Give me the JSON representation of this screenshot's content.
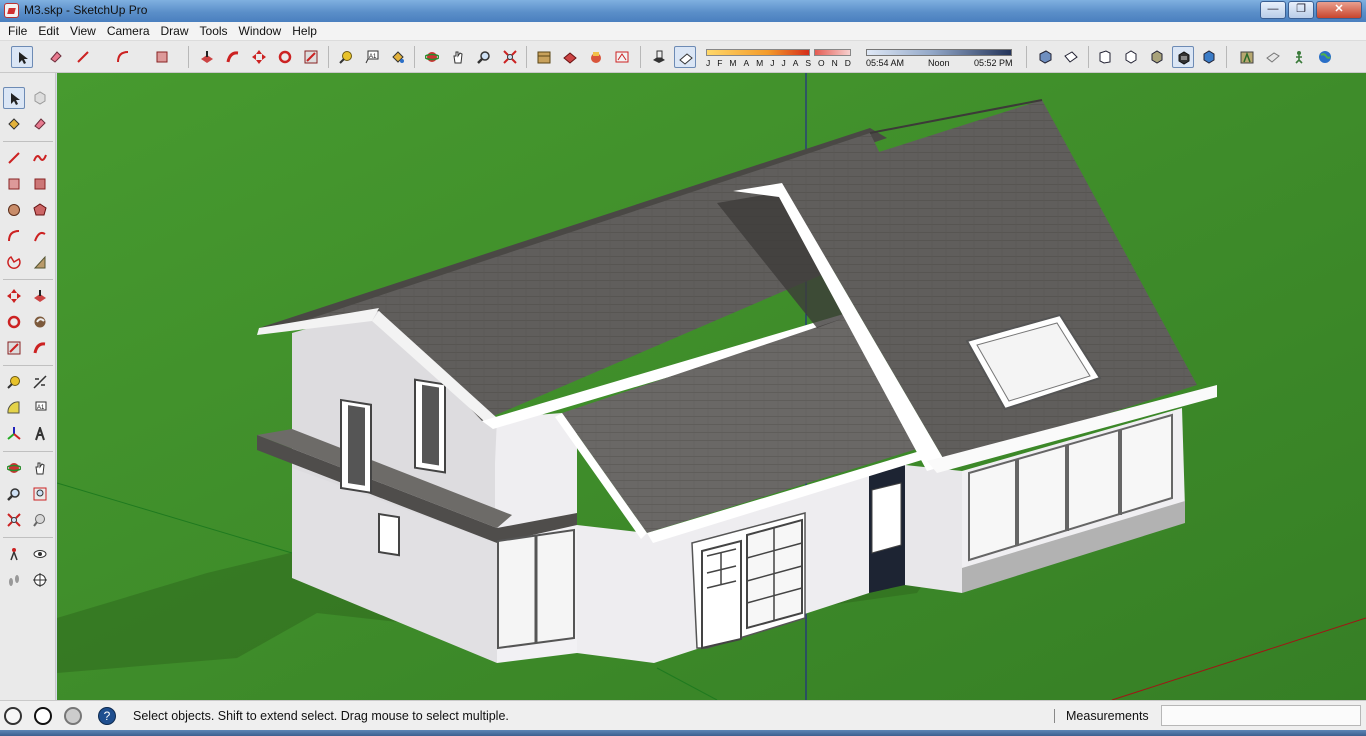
{
  "window": {
    "title": "M3.skp - SketchUp Pro",
    "minimize_glyph": "—",
    "maximize_glyph": "❐",
    "close_glyph": "✕"
  },
  "menu": [
    "File",
    "Edit",
    "View",
    "Camera",
    "Draw",
    "Tools",
    "Window",
    "Help"
  ],
  "toolbar": {
    "icons": [
      "select-icon",
      "eraser-icon",
      "line-icon",
      "arc-icon",
      "rectangle-icon",
      "push-pull-icon",
      "follow-me-icon",
      "move-icon",
      "rotate-icon",
      "scale-icon",
      "tape-measure-icon",
      "text-icon",
      "paint-bucket-icon",
      "orbit-icon",
      "pan-icon",
      "zoom-icon",
      "zoom-extents-icon",
      "warehouse-icon",
      "share-model-icon",
      "components-icon",
      "extension-icon",
      "shadows-icon",
      "fog-icon",
      "iso-view-icon",
      "top-view-icon",
      "front-view-icon",
      "right-view-icon",
      "back-view-icon",
      "left-view-icon",
      "xray-icon",
      "wireframe-icon",
      "hidden-line-icon",
      "shaded-icon",
      "monochrome-icon",
      "location-icon",
      "section-icon",
      "walk-icon",
      "earth-icon"
    ],
    "shadow_months": [
      "J",
      "F",
      "M",
      "A",
      "M",
      "J",
      "J",
      "A",
      "S",
      "O",
      "N",
      "D"
    ],
    "time_start": "05:54 AM",
    "time_mid": "Noon",
    "time_end": "05:52 PM"
  },
  "left_toolbar": {
    "tools": [
      "select-icon",
      "make-component-icon",
      "paint-bucket-icon",
      "eraser-icon",
      "line-icon",
      "freehand-icon",
      "rectangle-icon",
      "rotated-rectangle-icon",
      "circle-icon",
      "polygon-icon",
      "arc-icon",
      "two-point-arc-icon",
      "pie-icon",
      "three-point-arc-icon",
      "move-icon",
      "push-pull-icon",
      "rotate-icon",
      "follow-me-icon",
      "scale-icon",
      "offset-icon",
      "tape-measure-icon",
      "dimension-icon",
      "protractor-icon",
      "text-icon",
      "axes-icon",
      "3d-text-icon",
      "orbit-icon",
      "pan-icon",
      "zoom-icon",
      "zoom-window-icon",
      "zoom-extents-icon",
      "previous-view-icon",
      "position-camera-icon",
      "look-around-icon",
      "walk-icon",
      "section-plane-icon"
    ]
  },
  "status": {
    "message": "Select objects. Shift to extend select. Drag mouse to select multiple.",
    "measurements_label": "Measurements",
    "measurements_value": ""
  },
  "colors": {
    "ground": "#3f8f2a",
    "roof": "#5f5d5b",
    "wall": "#e9e8ec",
    "accent": "#1f4f8f"
  }
}
